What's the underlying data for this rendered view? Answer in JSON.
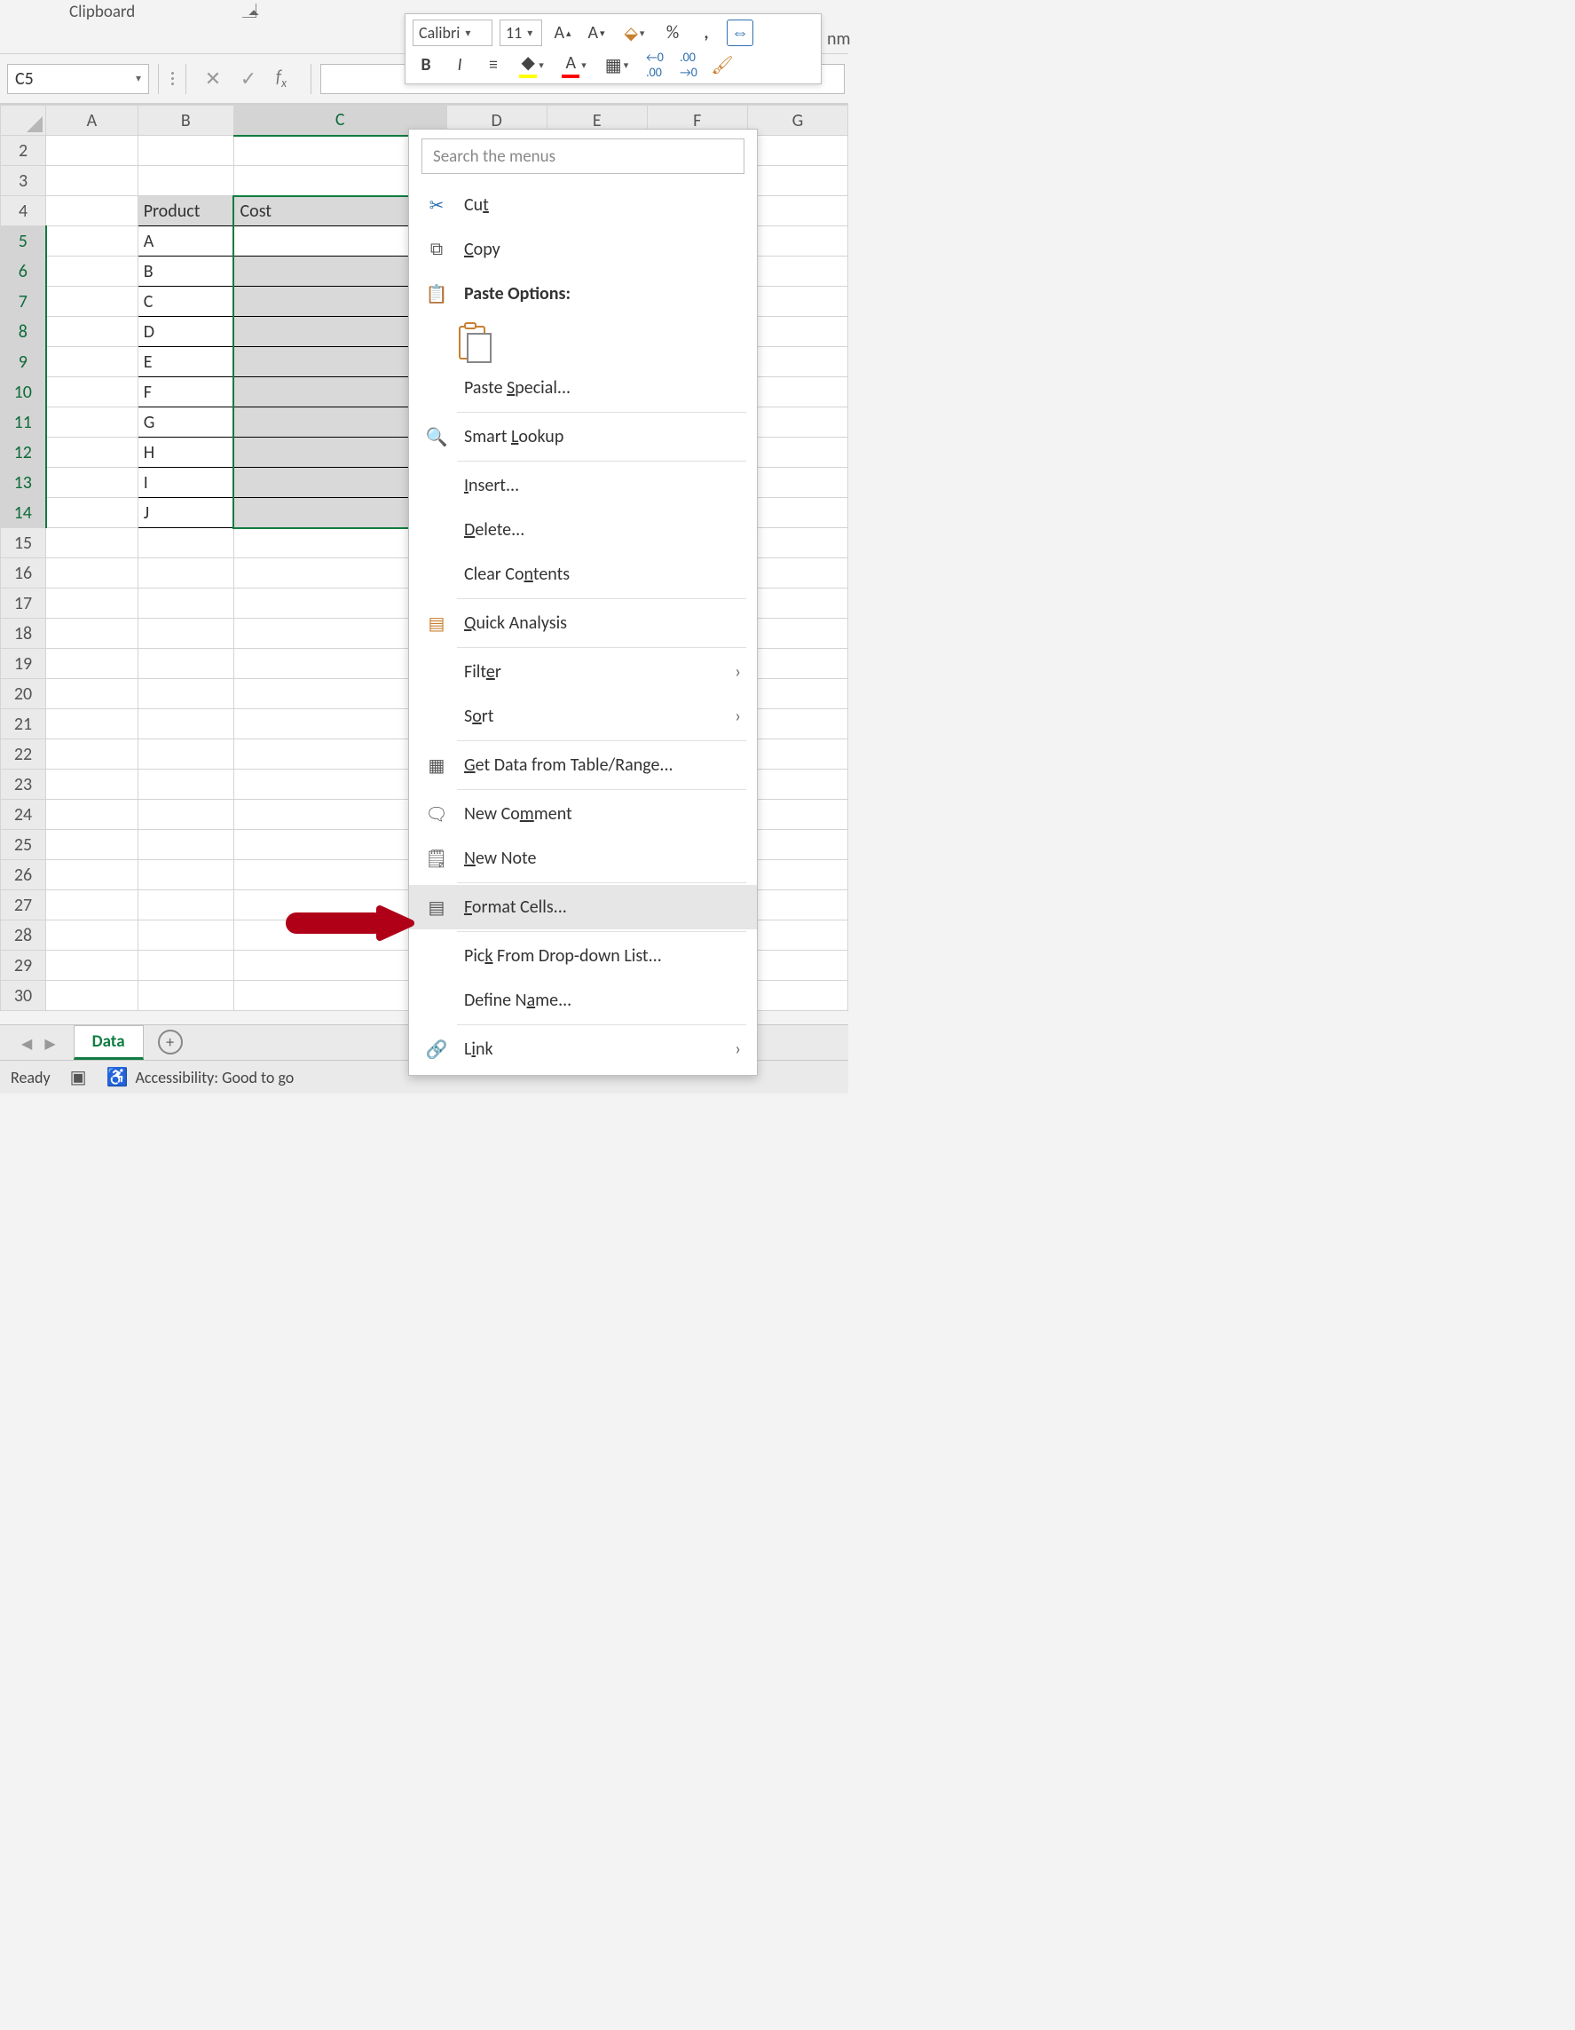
{
  "ribbon": {
    "group_label": "Clipboard"
  },
  "name_box": {
    "value": "C5"
  },
  "mini_toolbar": {
    "font_name": "Calibri",
    "font_size": "11",
    "cutoff_text": "nm"
  },
  "columns": [
    "A",
    "B",
    "C",
    "D",
    "E",
    "F",
    "G"
  ],
  "rows": [
    "2",
    "3",
    "4",
    "5",
    "6",
    "7",
    "8",
    "9",
    "10",
    "11",
    "12",
    "13",
    "14",
    "15",
    "16",
    "17",
    "18",
    "19",
    "20",
    "21",
    "22",
    "23",
    "24",
    "25",
    "26",
    "27",
    "28",
    "29",
    "30"
  ],
  "table": {
    "headers": {
      "product": "Product",
      "cost": "Cost"
    },
    "products": [
      "A",
      "B",
      "C",
      "D",
      "E",
      "F",
      "G",
      "H",
      "I",
      "J"
    ]
  },
  "context_menu": {
    "search_placeholder": "Search the menus",
    "cut": "Cut",
    "copy": "Copy",
    "paste_options": "Paste Options:",
    "paste_special": "Paste Special...",
    "smart_lookup": "Smart Lookup",
    "insert": "Insert...",
    "delete": "Delete...",
    "clear_contents": "Clear Contents",
    "quick_analysis": "Quick Analysis",
    "filter": "Filter",
    "sort": "Sort",
    "get_data": "Get Data from Table/Range...",
    "new_comment": "New Comment",
    "new_note": "New Note",
    "format_cells": "Format Cells...",
    "pick_list": "Pick From Drop-down List...",
    "define_name": "Define Name...",
    "link": "Link"
  },
  "tabs": {
    "sheet_name": "Data"
  },
  "status": {
    "ready": "Ready",
    "accessibility": "Accessibility: Good to go"
  }
}
